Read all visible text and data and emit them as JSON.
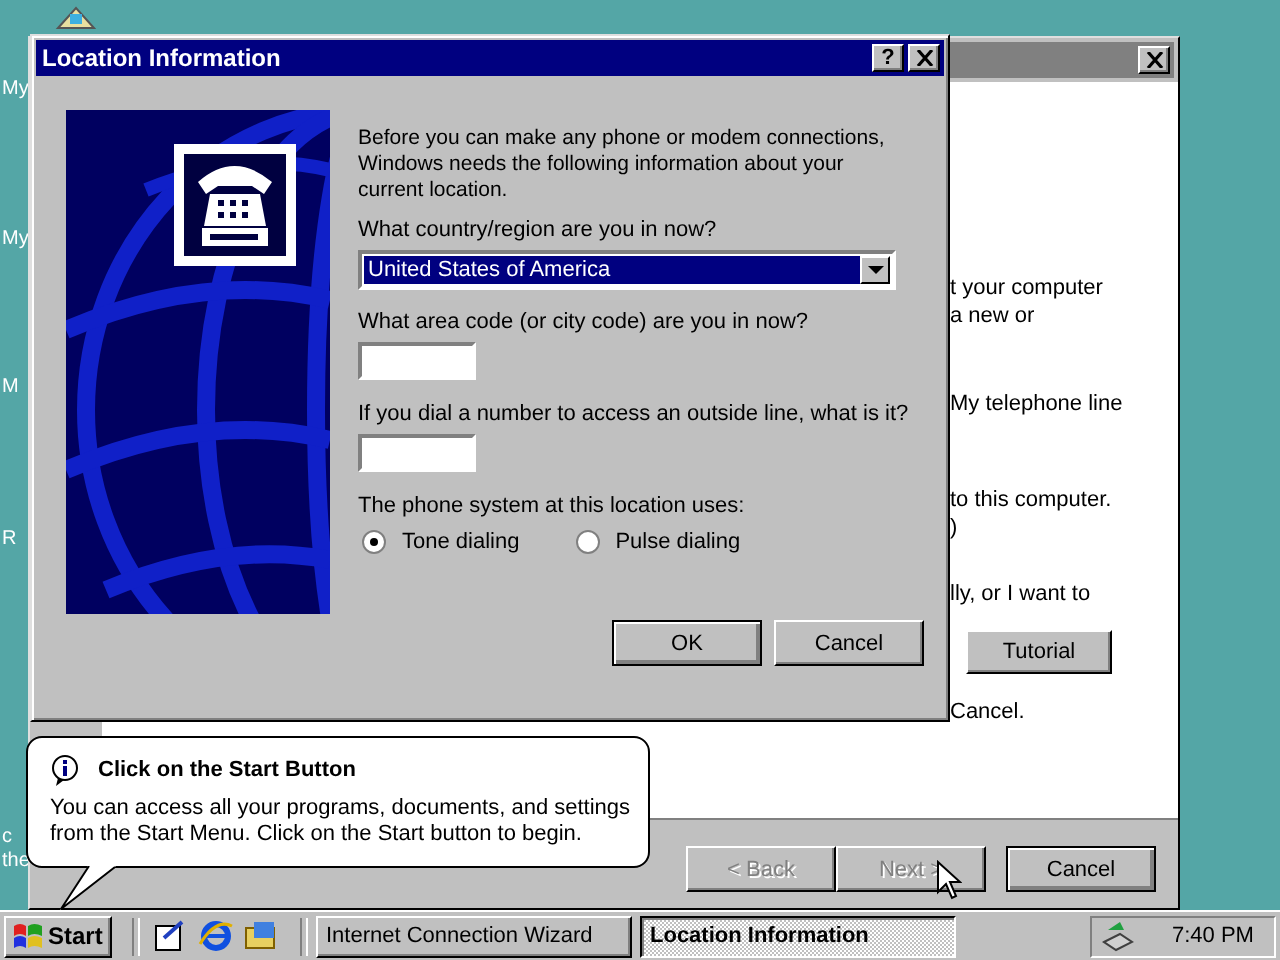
{
  "desktop": {
    "icon_labels": [
      "My",
      "My",
      "M",
      "R",
      "c",
      "the"
    ]
  },
  "wizard": {
    "text_fragments": [
      "t your computer",
      "a new or",
      "My telephone line",
      "to this computer.",
      ")",
      "lly, or I want to",
      "Cancel."
    ],
    "tutorial_button": "Tutorial",
    "buttons": [
      {
        "label": "< Back",
        "disabled": true
      },
      {
        "label": "Next >",
        "disabled": true
      },
      {
        "label": "Cancel",
        "disabled": false
      }
    ]
  },
  "dialog": {
    "title": "Location Information",
    "help_button": "?",
    "intro": "Before you can make any phone or modem connections, Windows needs the following information about your current location.",
    "country_label": "What country/region are you in now?",
    "country_value": "United States of America",
    "area_code_label": "What area code (or city code) are you in now?",
    "outside_line_label": "If you dial a number to access an outside line, what is it?",
    "phone_system_label": "The phone system at this location uses:",
    "dialing": [
      {
        "label": "Tone dialing",
        "selected": true
      },
      {
        "label": "Pulse dialing",
        "selected": false
      }
    ],
    "buttons": [
      {
        "label": "OK",
        "default": true
      },
      {
        "label": "Cancel",
        "default": false
      }
    ]
  },
  "callout": {
    "title": "Click on the Start Button",
    "body": "You can access all your programs, documents, and settings from the Start Menu. Click on the Start button to begin."
  },
  "taskbar": {
    "start": "Start",
    "tasks": [
      {
        "label": "Internet Connection Wizard",
        "selected": false
      },
      {
        "label": "Location Information",
        "selected": true
      }
    ],
    "clock": "7:40 PM"
  }
}
